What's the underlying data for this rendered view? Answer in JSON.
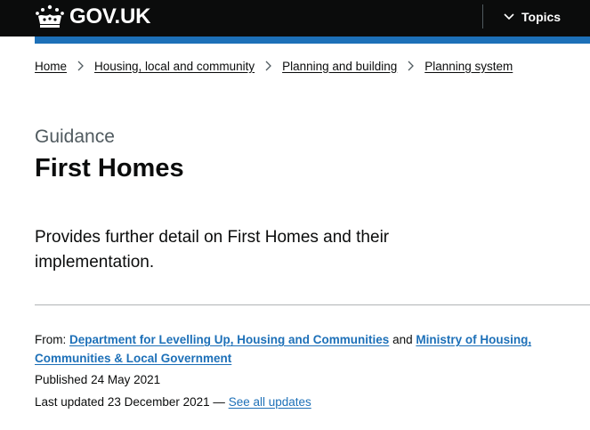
{
  "header": {
    "logo_text": "GOV.UK",
    "topics_label": "Topics"
  },
  "breadcrumb": [
    {
      "label": "Home"
    },
    {
      "label": "Housing, local and community"
    },
    {
      "label": "Planning and building"
    },
    {
      "label": "Planning system"
    }
  ],
  "page": {
    "caption": "Guidance",
    "title": "First Homes",
    "lead": "Provides further detail on First Homes and their implementation."
  },
  "meta": {
    "from_label": "From:",
    "org1": "Department for Levelling Up, Housing and Communities",
    "and_text": "and",
    "org2": "Ministry of Housing, Communities & Local Government",
    "published_label": "Published",
    "published_date": "24 May 2021",
    "updated_label": "Last updated",
    "updated_date": "23 December 2021 —",
    "see_all_updates": "See all updates"
  },
  "colors": {
    "header_bg": "#0b0c0c",
    "accent_blue": "#1d70b8",
    "link_blue": "#1d70b8",
    "secondary_text": "#505a5f",
    "rule": "#b1b4b6"
  },
  "icons": {
    "logo": "crown-icon",
    "topics": "chevron-down-icon",
    "breadcrumb_separator": "chevron-right-icon"
  }
}
